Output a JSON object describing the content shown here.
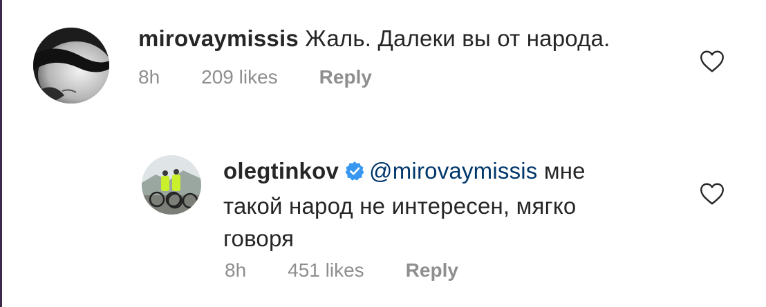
{
  "comments": [
    {
      "username": "mirovaymissis",
      "text": "Жаль. Далеки вы от народа.",
      "time": "8h",
      "likes": "209 likes",
      "reply_label": "Reply",
      "avatar_icon": "avatar-photo-face",
      "like_icon": "heart-icon"
    },
    {
      "username": "olegtinkov",
      "verified": true,
      "mention": "@mirovaymissis",
      "text_line1": "мне",
      "text_line2": "такой народ не интересен, мягко",
      "text_line3": "говоря",
      "time": "8h",
      "likes": "451 likes",
      "reply_label": "Reply",
      "avatar_icon": "avatar-photo-cyclists",
      "like_icon": "heart-icon"
    }
  ],
  "colors": {
    "text": "#262626",
    "meta": "#8e8e8e",
    "mention": "#00376b",
    "verified": "#3897f0"
  }
}
